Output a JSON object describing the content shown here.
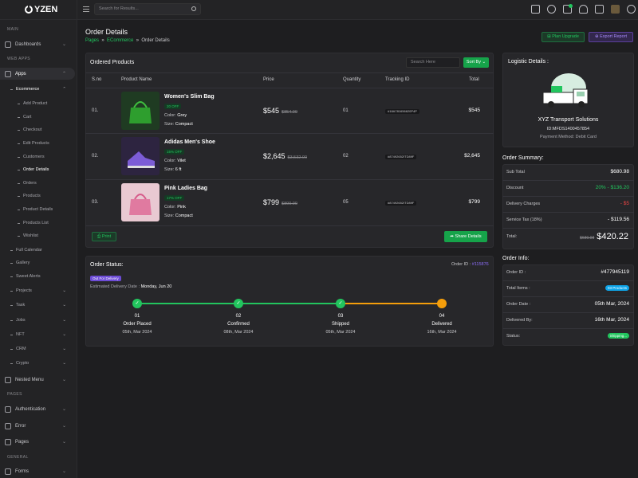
{
  "logo": {
    "text": "YZEN"
  },
  "topbar": {
    "search_placeholder": "Search for Results..."
  },
  "sidebar": {
    "head_main": "MAIN",
    "dashboards": "Dashboards",
    "head_webapps": "WEB APPS",
    "apps": "Apps",
    "ecommerce": "Ecommerce",
    "ecom_items": [
      "Add Product",
      "Cart",
      "Checkout",
      "Edit Products",
      "Customers",
      "Order Details",
      "Orders",
      "Products",
      "Product Details",
      "Products List",
      "Wishlist"
    ],
    "items2": [
      "Full Calendar",
      "Gallery",
      "Sweet Alerts",
      "Projects",
      "Task",
      "Jobs",
      "NFT",
      "CRM",
      "Crypto"
    ],
    "nested": "Nested Menu",
    "head_pages": "PAGES",
    "pages_items": [
      "Authentication",
      "Error",
      "Pages"
    ],
    "head_general": "GENERAL",
    "forms": "Forms"
  },
  "page": {
    "title": "Order Details",
    "crumb_1": "Pages",
    "crumb_2": "ECommerce",
    "crumb_3": "Order Details",
    "plan_upgrade": "Plan Upgrade",
    "export_report": "Export Report"
  },
  "products": {
    "title": "Ordered Products",
    "search_placeholder": "Search Here",
    "sort_label": "Sort By",
    "headers": {
      "sno": "S.no",
      "name": "Product Name",
      "price": "Price",
      "qty": "Quantity",
      "track": "Tracking ID",
      "total": "Total"
    },
    "rows": [
      {
        "sno": "01.",
        "name": "Women's Slim Bag",
        "badge": "20 OFF",
        "color_label": "Color:",
        "color": "Grey",
        "size_label": "Size:",
        "size": "Compact",
        "price": "$545",
        "old": "$854.00",
        "qty": "01",
        "track": "#18A781656620P4P",
        "total": "$545"
      },
      {
        "sno": "02.",
        "name": "Adidas Men's Shoe",
        "badge": "15% OFF",
        "color_label": "Color:",
        "color": "Vilet",
        "size_label": "Size:",
        "size": "6 ft",
        "price": "$2,645",
        "old": "$3,532.00",
        "qty": "02",
        "track": "#87492652ITD89F",
        "total": "$2,645"
      },
      {
        "sno": "03.",
        "name": "Pink Ladies Bag",
        "badge": "17% OFF",
        "color_label": "Color:",
        "color": "Pink",
        "size_label": "Size:",
        "size": "Compact",
        "price": "$799",
        "old": "$800.00",
        "qty": "05",
        "track": "#87492652ITD89F",
        "total": "$799"
      }
    ],
    "print_label": "Print",
    "share_label": "Share Details"
  },
  "status": {
    "title": "Order Status:",
    "order_id_label": "Order ID :",
    "order_id": "#115876",
    "badge": "Out For Delivery",
    "est_label": "Estimated Delivery Date :",
    "est_date": "Monday, Jun 20",
    "steps": [
      {
        "n": "01",
        "label": "Order Placed",
        "date": "05th, Mar 2024",
        "done": true
      },
      {
        "n": "02",
        "label": "Confirmed",
        "date": "08th, Mar 2024",
        "done": true
      },
      {
        "n": "03",
        "label": "Shipped",
        "date": "05th, Mar 2024",
        "done": true
      },
      {
        "n": "04",
        "label": "Delivered",
        "date": "16th, Mar 2024",
        "done": false
      }
    ]
  },
  "logistic": {
    "title": "Logistic Details :",
    "company": "XYZ Transport Solutions",
    "id": "ID:MFDS1400457854",
    "payment": "Payment Method: Debit Card"
  },
  "summary": {
    "title": "Order Summary:",
    "rows": [
      {
        "label": "Sub Total",
        "value": "$680.98",
        "color": "#ffffff"
      },
      {
        "label": "Discount",
        "value": "20% - $136.20",
        "color": "#22c55e"
      },
      {
        "label": "Delivery Charges",
        "value": "- $5",
        "color": "#ef4444"
      },
      {
        "label": "Service Tax (18%)",
        "value": "- $119.56",
        "color": "#ffffff"
      }
    ],
    "total_label": "Total:",
    "total_old": "$680.98",
    "total": "$420.22"
  },
  "info": {
    "title": "Order Info:",
    "order_id_label": "Order ID :",
    "order_id": "#477945119",
    "items_label": "Total Items :",
    "items": "03 Products",
    "date_label": "Order Date :",
    "date": "05th Mar, 2024",
    "deliv_label": "Delivered By:",
    "deliv": "16th Mar, 2024",
    "status_label": "Status:",
    "status": "Shipping..."
  },
  "colors": {
    "accent": "#22c55e",
    "purple": "#6d4cd6",
    "orange": "#f59e0b"
  }
}
